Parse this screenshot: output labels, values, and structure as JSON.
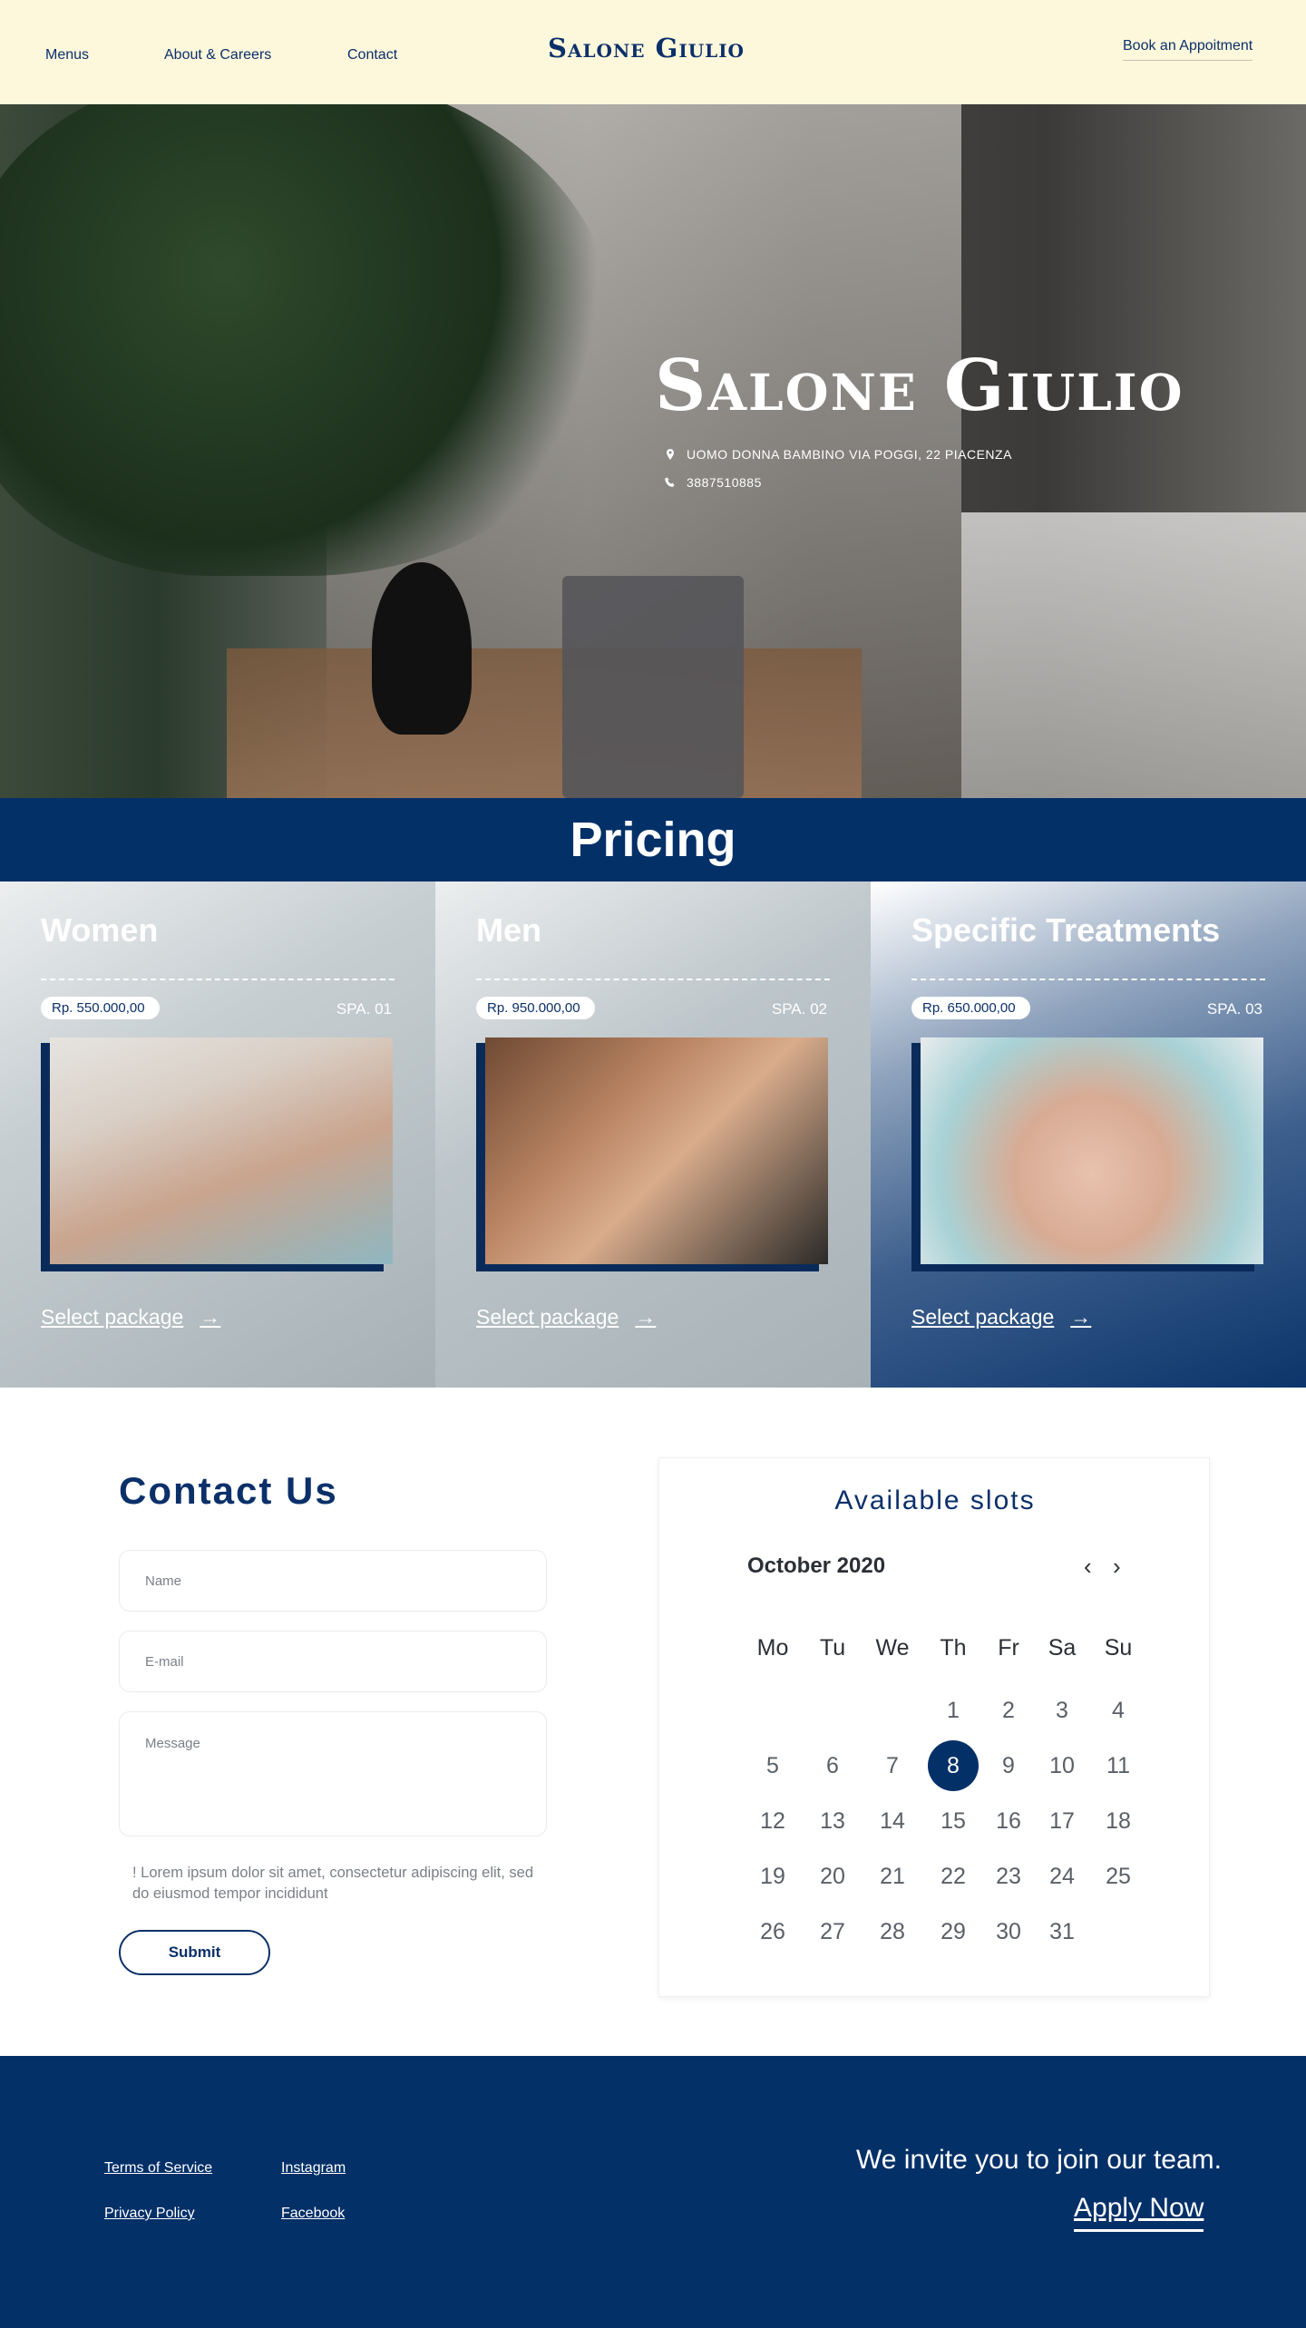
{
  "nav": {
    "menu_items": [
      "Menus",
      "About & Careers",
      "Contact"
    ],
    "brand": "Salone Giulio",
    "cta": "Book an Appoitment"
  },
  "hero": {
    "title": "Salone Giulio",
    "address": "UOMO DONNA BAMBINO VIA POGGI, 22 PIACENZA",
    "phone": "3887510885",
    "icons": [
      "location-pin-icon",
      "phone-icon"
    ]
  },
  "pricing": {
    "title": "Pricing",
    "cards": [
      {
        "title": "Women",
        "price": "Rp. 550.000,00",
        "code": "SPA. 01",
        "cta": "Select package"
      },
      {
        "title": "Men",
        "price": "Rp. 950.000,00",
        "code": "SPA. 02",
        "cta": "Select package"
      },
      {
        "title": "Specific Treatments",
        "price": "Rp. 650.000,00",
        "code": "SPA. 03",
        "cta": "Select package"
      }
    ]
  },
  "contact": {
    "title": "Contact Us",
    "name_placeholder": "Name",
    "email_placeholder": "E-mail",
    "message_placeholder": "Message",
    "note": "! Lorem ipsum dolor sit amet, consectetur adipiscing elit, sed do eiusmod tempor incididunt",
    "submit": "Submit"
  },
  "calendar": {
    "title": "Available slots",
    "month": "October 2020",
    "weekdays": [
      "Mo",
      "Tu",
      "We",
      "Th",
      "Fr",
      "Sa",
      "Su"
    ],
    "days": [
      "1",
      "2",
      "3",
      "4",
      "5",
      "6",
      "7",
      "8",
      "9",
      "10",
      "11",
      "12",
      "13",
      "14",
      "15",
      "16",
      "17",
      "18",
      "19",
      "20",
      "21",
      "22",
      "23",
      "24",
      "25",
      "26",
      "27",
      "28",
      "29",
      "30",
      "31"
    ],
    "selected_day": "8"
  },
  "footer": {
    "links": [
      "Terms of Service",
      "Instagram",
      "Privacy Policy",
      "Facebook"
    ],
    "invite": "We invite you to join our team.",
    "apply": "Apply Now"
  },
  "colors": {
    "navy": "#043068",
    "cream": "#fdf7dc",
    "white": "#ffffff"
  }
}
